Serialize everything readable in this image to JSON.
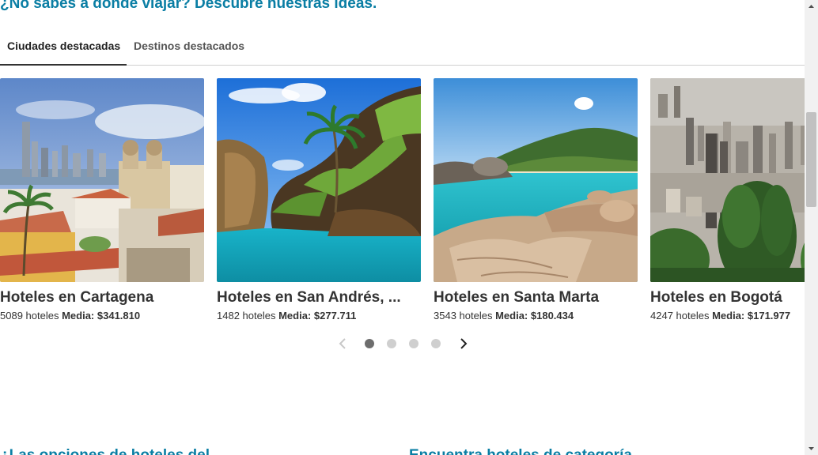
{
  "heading": "¿No sabes a dónde viajar? Descubre nuestras ideas.",
  "tabs": [
    {
      "label": "Ciudades destacadas",
      "active": true
    },
    {
      "label": "Destinos destacados",
      "active": false
    }
  ],
  "cards": [
    {
      "title": "Hoteles en Cartagena",
      "count": "5089 hoteles",
      "avg_label": "Media:",
      "avg_value": "$341.810"
    },
    {
      "title": "Hoteles en San Andrés, ...",
      "count": "1482 hoteles",
      "avg_label": "Media:",
      "avg_value": "$277.711"
    },
    {
      "title": "Hoteles en Santa Marta",
      "count": "3543 hoteles",
      "avg_label": "Media:",
      "avg_value": "$180.434"
    },
    {
      "title": "Hoteles en Bogotá",
      "count": "4247 hoteles",
      "avg_label": "Media:",
      "avg_value": "$171.977"
    }
  ],
  "pager": {
    "pages": 4,
    "current": 1,
    "prev_icon": "chevron-left-icon",
    "next_icon": "chevron-right-icon"
  },
  "bottom_headings": [
    "¿Las opciones de hoteles del...",
    "Encuentra hoteles de categoría..."
  ],
  "colors": {
    "accent": "#0a7ea4",
    "dot_active": "#6d6d6d",
    "dot_inactive": "#cfcfcf"
  }
}
